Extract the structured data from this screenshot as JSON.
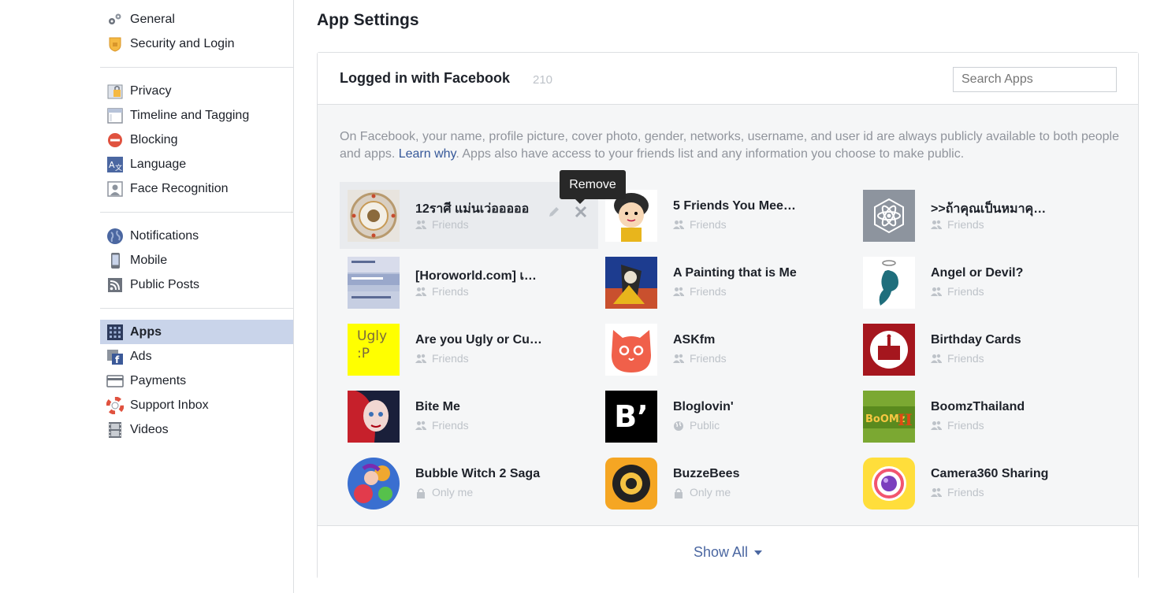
{
  "sidebar": {
    "groups": [
      [
        {
          "label": "General",
          "icon": "gears-icon"
        },
        {
          "label": "Security and Login",
          "icon": "shield-icon"
        }
      ],
      [
        {
          "label": "Privacy",
          "icon": "lock-icon"
        },
        {
          "label": "Timeline and Tagging",
          "icon": "timeline-icon"
        },
        {
          "label": "Blocking",
          "icon": "block-icon"
        },
        {
          "label": "Language",
          "icon": "language-icon"
        },
        {
          "label": "Face Recognition",
          "icon": "face-recognition-icon"
        }
      ],
      [
        {
          "label": "Notifications",
          "icon": "globe-icon"
        },
        {
          "label": "Mobile",
          "icon": "mobile-icon"
        },
        {
          "label": "Public Posts",
          "icon": "rss-icon"
        }
      ],
      [
        {
          "label": "Apps",
          "icon": "apps-icon",
          "active": true
        },
        {
          "label": "Ads",
          "icon": "ads-icon"
        },
        {
          "label": "Payments",
          "icon": "card-icon"
        },
        {
          "label": "Support Inbox",
          "icon": "lifebuoy-icon"
        },
        {
          "label": "Videos",
          "icon": "film-icon"
        }
      ]
    ]
  },
  "main": {
    "title": "App Settings",
    "panel": {
      "heading": "Logged in with Facebook",
      "count": "210",
      "search_placeholder": "Search Apps",
      "info_before": "On Facebook, your name, profile picture, cover photo, gender, networks, username, and user id are always publicly available to both people and apps. ",
      "info_link": "Learn why",
      "info_after": ". Apps also have access to your friends list and any information you choose to make public.",
      "tooltip": "Remove",
      "show_all": "Show All"
    },
    "apps": [
      {
        "name": "12ราศี แม่นเว่อออออ",
        "audience": "Friends",
        "aud_icon": "friends",
        "thumb": "zodiac",
        "hover": true
      },
      {
        "name": "5 Friends You Mee…",
        "audience": "Friends",
        "aud_icon": "friends",
        "thumb": "cartoon"
      },
      {
        "name": ">>ถ้าคุณเป็นหมาคุ…",
        "audience": "Friends",
        "aud_icon": "friends",
        "thumb": "atom"
      },
      {
        "name": "[Horoworld.com] เ…",
        "audience": "Friends",
        "aud_icon": "friends",
        "thumb": "horoworld"
      },
      {
        "name": "A Painting that is Me",
        "audience": "Friends",
        "aud_icon": "friends",
        "thumb": "painting"
      },
      {
        "name": "Angel or Devil?",
        "audience": "Friends",
        "aud_icon": "friends",
        "thumb": "angel"
      },
      {
        "name": "Are you Ugly or Cu…",
        "audience": "Friends",
        "aud_icon": "friends",
        "thumb": "ugly",
        "thumb_text": "Ugly\n:P"
      },
      {
        "name": "ASKfm",
        "audience": "Friends",
        "aud_icon": "friends",
        "thumb": "askfm"
      },
      {
        "name": "Birthday Cards",
        "audience": "Friends",
        "aud_icon": "friends",
        "thumb": "birthday"
      },
      {
        "name": "Bite Me",
        "audience": "Friends",
        "aud_icon": "friends",
        "thumb": "biteme"
      },
      {
        "name": "Bloglovin'",
        "audience": "Public",
        "aud_icon": "public",
        "thumb": "bloglovin",
        "thumb_text": "B’"
      },
      {
        "name": "BoomzThailand",
        "audience": "Friends",
        "aud_icon": "friends",
        "thumb": "boomz"
      },
      {
        "name": "Bubble Witch 2 Saga",
        "audience": "Only me",
        "aud_icon": "lock",
        "thumb": "bubble"
      },
      {
        "name": "BuzzeBees",
        "audience": "Only me",
        "aud_icon": "lock",
        "thumb": "buzzebees"
      },
      {
        "name": "Camera360 Sharing",
        "audience": "Friends",
        "aud_icon": "friends",
        "thumb": "camera360"
      }
    ]
  }
}
